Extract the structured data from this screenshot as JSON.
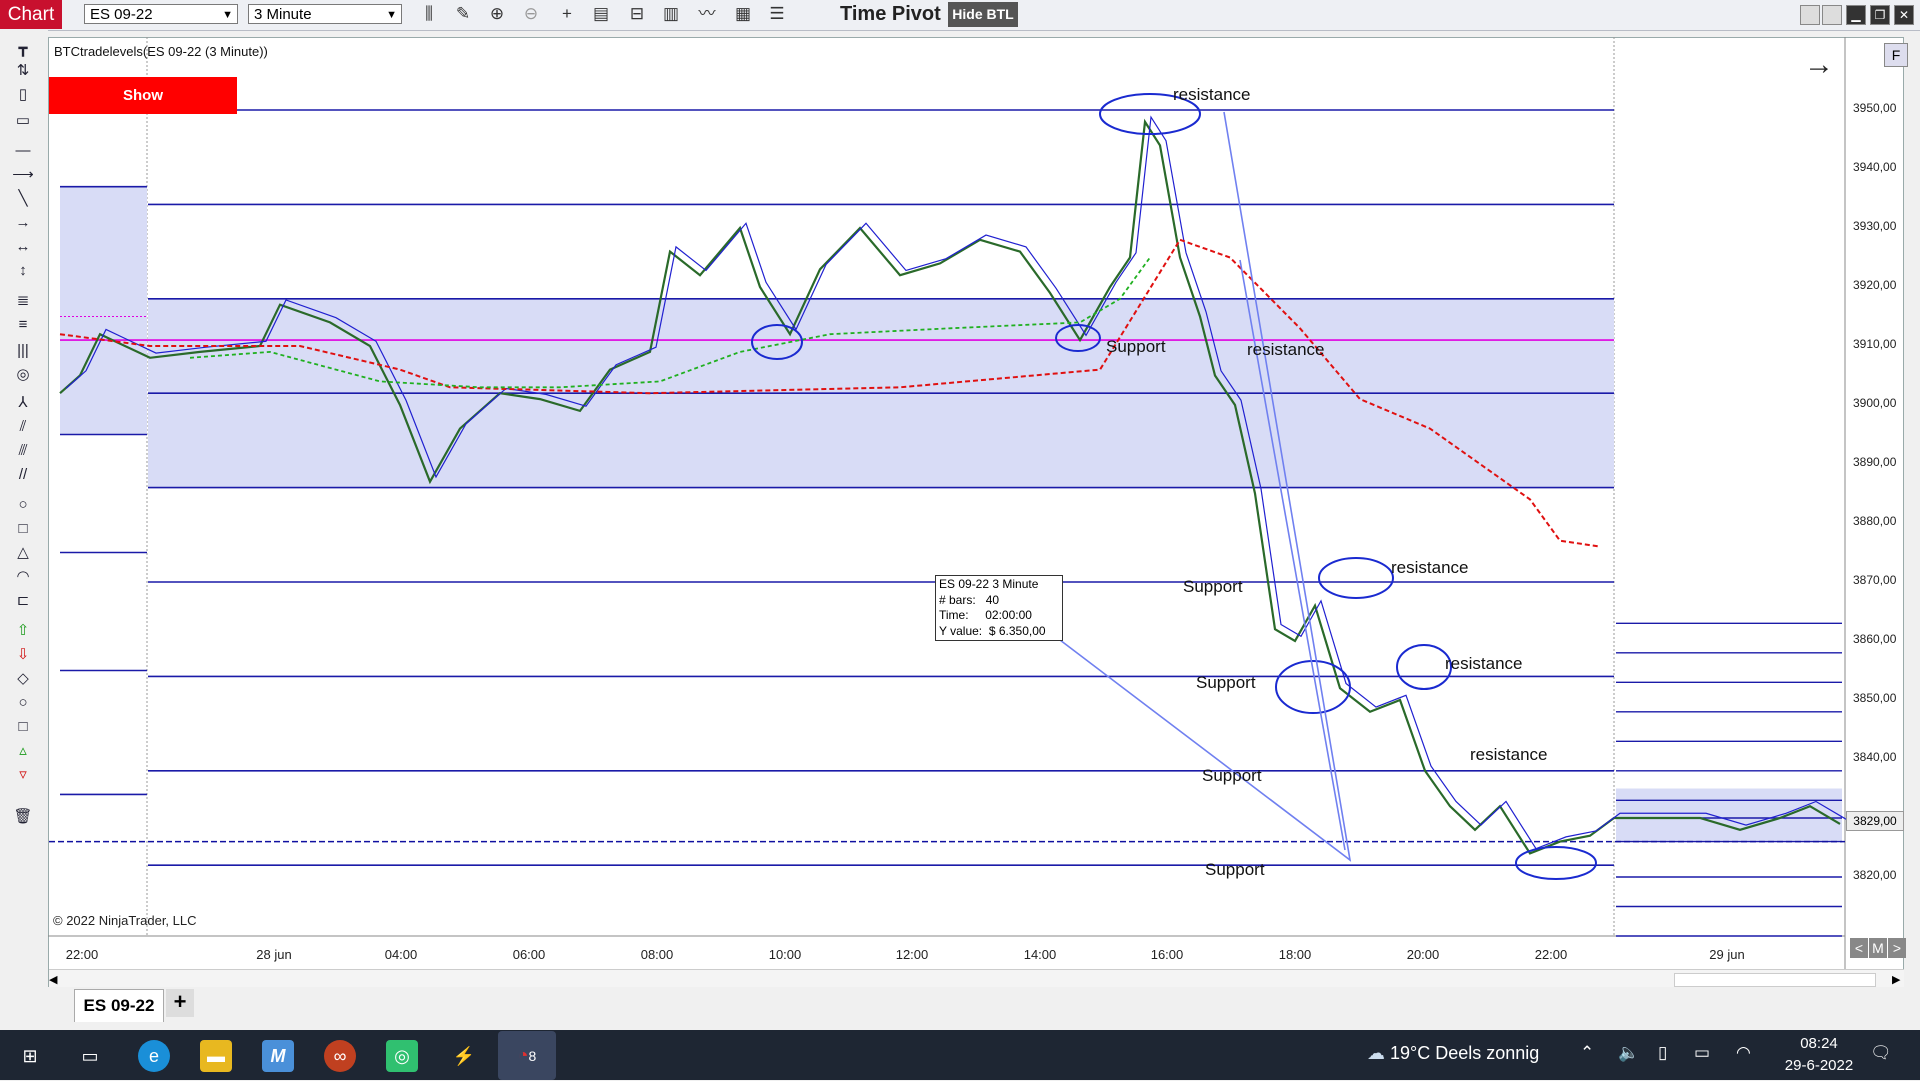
{
  "toolbar": {
    "chart_label": "Chart",
    "instrument": "ES 09-22",
    "interval": "3 Minute",
    "time_pivot": "Time Pivot",
    "hide_btl": "Hide BTL"
  },
  "chart": {
    "indicator_label": "BTCtradelevels(ES 09-22 (3 Minute))",
    "show_button": "Show",
    "copyright": "© 2022 NinjaTrader, LLC",
    "y_axis_ticks": [
      "3950,00",
      "3940,00",
      "3930,00",
      "3920,00",
      "3910,00",
      "3900,00",
      "3890,00",
      "3880,00",
      "3870,00",
      "3860,00",
      "3850,00",
      "3840,00",
      "3829,00",
      "3820,00"
    ],
    "x_axis_ticks": [
      "22:00",
      "28 jun",
      "04:00",
      "06:00",
      "08:00",
      "10:00",
      "12:00",
      "14:00",
      "16:00",
      "18:00",
      "20:00",
      "22:00",
      "29 jun"
    ],
    "current_price": "3829,00",
    "colors": {
      "level_line": "#1a1aa8",
      "zone_fill": "#d8dcf6",
      "pivot_line": "#e000e0",
      "ma_red": "#e01010",
      "ma_green": "#20b020",
      "ma_blue": "#2020d0",
      "annotation": "#1a2ad0",
      "show_button": "#ff0000"
    },
    "tooltip": {
      "title": "ES 09-22 3 Minute",
      "bars_label": "# bars:",
      "bars_value": "40",
      "time_label": "Time:",
      "time_value": "02:00:00",
      "y_label": "Y value:",
      "y_value": "$ 6.350,00"
    },
    "annotations": {
      "resistance": "resistance",
      "support": "Support"
    },
    "zoom_buttons": [
      "<",
      "M",
      ">"
    ],
    "f_button": "F"
  },
  "tabs": {
    "active": "ES 09-22",
    "add": "+"
  },
  "taskbar": {
    "weather": "19°C  Deels zonnig",
    "time": "08:24",
    "date": "29-6-2022",
    "ninja_badge": "8"
  }
}
